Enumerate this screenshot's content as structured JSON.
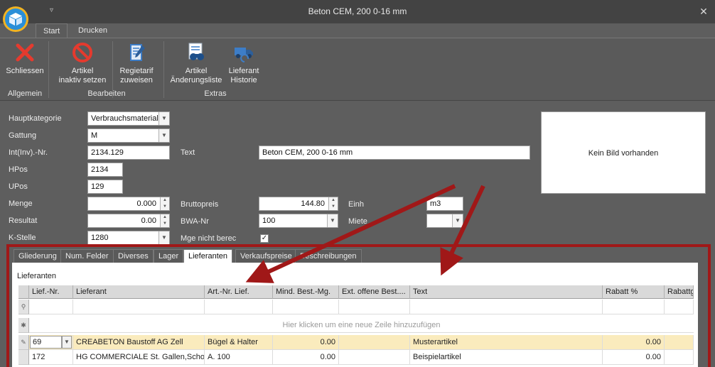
{
  "window": {
    "title": "Beton CEM, 200  0-16 mm"
  },
  "ribbon": {
    "tabs": [
      "Start",
      "Drucken"
    ],
    "buttons": {
      "close": "Schliessen",
      "inactive_1": "Artikel",
      "inactive_2": "inaktiv setzen",
      "regie_1": "Regietarif",
      "regie_2": "zuweisen",
      "changes_1": "Artikel",
      "changes_2": "Änderungsliste",
      "supplier_1": "Lieferant",
      "supplier_2": "Historie"
    },
    "groups": [
      "Allgemein",
      "Bearbeiten",
      "Extras"
    ]
  },
  "form": {
    "hauptkategorie": {
      "label": "Hauptkategorie",
      "value": "Verbrauchsmaterial"
    },
    "gattung": {
      "label": "Gattung",
      "value": "M"
    },
    "int_nr": {
      "label": "Int(Inv).-Nr.",
      "value": "2134.129"
    },
    "text": {
      "label": "Text",
      "value": "Beton CEM, 200  0-16 mm"
    },
    "hpos": {
      "label": "HPos",
      "value": "2134"
    },
    "upos": {
      "label": "UPos",
      "value": "129"
    },
    "menge": {
      "label": "Menge",
      "value": "0.000"
    },
    "bruttopreis": {
      "label": "Bruttopreis",
      "value": "144.80"
    },
    "einh": {
      "label": "Einh",
      "value": "m3"
    },
    "resultat": {
      "label": "Resultat",
      "value": "0.00"
    },
    "bwa_nr": {
      "label": "BWA-Nr",
      "value": "100"
    },
    "miete": {
      "label": "Miete",
      "value": ""
    },
    "k_stelle": {
      "label": "K-Stelle",
      "value": "1280"
    },
    "mge": {
      "label": "Mge nicht berec",
      "checked": true
    },
    "image_placeholder": "Kein Bild vorhanden"
  },
  "detail_tabs": [
    "Gliederung",
    "Num. Felder",
    "Diverses",
    "Lager",
    "Lieferanten",
    "Verkaufspreise",
    "Beschreibungen"
  ],
  "active_tab": "Lieferanten",
  "grid": {
    "caption": "Lieferanten",
    "columns": [
      "Lief.-Nr.",
      "Lieferant",
      "Art.-Nr. Lief.",
      "Mind. Best.-Mg.",
      "Ext. offene Best....",
      "Text",
      "Rabatt %",
      "Rabattg"
    ],
    "new_row_hint": "Hier klicken um eine neue Zeile hinzuzufügen",
    "rows": [
      {
        "lief_nr": "69",
        "lieferant": "CREABETON Baustoff AG Zell",
        "art_nr": "Bügel & Halter",
        "mind": "0.00",
        "ext": "",
        "text": "Musterartikel",
        "rabatt": "0.00",
        "rabattg": ""
      },
      {
        "lief_nr": "172",
        "lieferant": "HG COMMERCIALE St. Gallen,Scho",
        "art_nr": "A. 100",
        "mind": "0.00",
        "ext": "",
        "text": "Beispielartikel",
        "rabatt": "0.00",
        "rabattg": ""
      }
    ]
  },
  "colors": {
    "annotation": "#a01818",
    "selected_row": "#faebbd",
    "ribbon_bg": "#5a5a5a"
  }
}
